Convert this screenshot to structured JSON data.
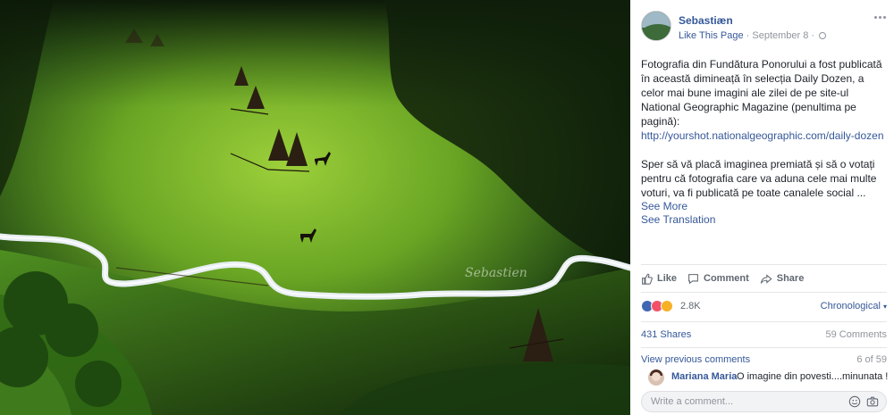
{
  "photo": {
    "description_watermark": "Sebastien",
    "colors": {
      "grass_lit": "#7ab52a",
      "grass_dark": "#1b3b12",
      "river": "#e8eef2",
      "shadow": "#0f1f0b"
    }
  },
  "post": {
    "page_name": "Sebastiæn",
    "like_page": "Like This Page",
    "date": "September 8",
    "separator": "·",
    "paragraph1": "Fotografia din Fundătura Ponorului a fost publicată în această dimineață în selecția Daily Dozen, a celor mai bune imagini ale zilei de pe site-ul National Geographic Magazine (penultima pe pagină):",
    "link": "http://yourshot.nationalgeographic.com/daily-dozen",
    "paragraph2": "Sper să vă placă imaginea premiată și să o votați pentru că fotografia care va aduna cele mai multe voturi, va fi publicată pe toate canalele social ...",
    "see_more": "See More",
    "see_translation": "See Translation"
  },
  "actions": {
    "like": "Like",
    "comment": "Comment",
    "share": "Share"
  },
  "reactions": {
    "count": "2.8K",
    "order": "Chronological",
    "icons": [
      "like-icon",
      "love-icon",
      "wow-icon"
    ]
  },
  "stats": {
    "shares": "431 Shares",
    "comments": "59 Comments"
  },
  "comments": {
    "view_previous": "View previous comments",
    "position": "6 of 59",
    "items": [
      {
        "name": "Mariana Maria",
        "text": "O imagine din povesti....minunata !"
      }
    ],
    "placeholder": "Write a comment..."
  }
}
